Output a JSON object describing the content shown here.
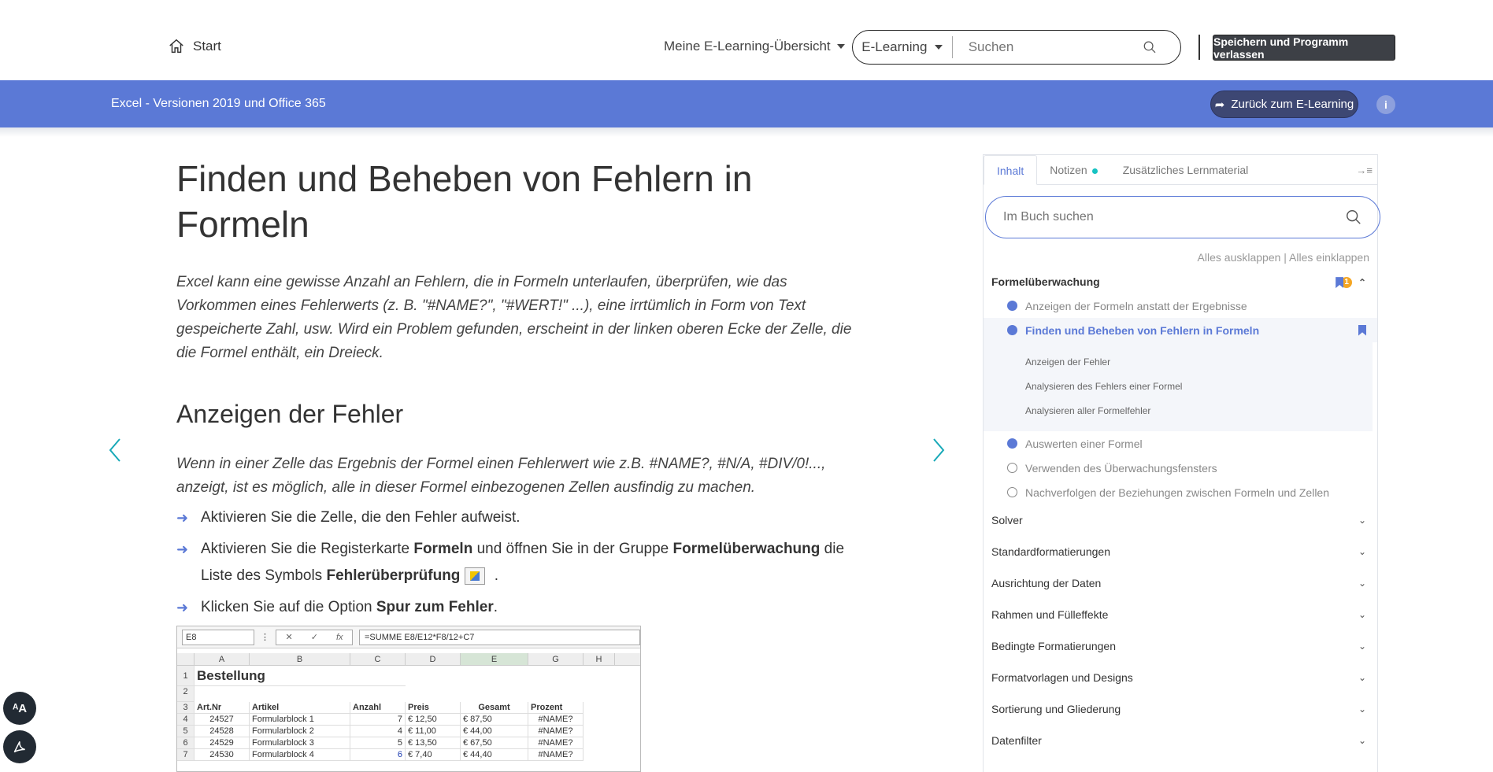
{
  "header": {
    "start": "Start",
    "overview": "Meine E-Learning-Übersicht",
    "search_scope": "E-Learning",
    "search_placeholder": "Suchen",
    "save_exit": "Speichern und Programm verlassen"
  },
  "course_bar": {
    "title": "Excel - Versionen 2019 und Office 365",
    "back": "Zurück zum E-Learning",
    "info": "i"
  },
  "content": {
    "title": "Finden und Beheben von Fehlern in Formeln",
    "intro": "Excel kann eine gewisse Anzahl an Fehlern, die in Formeln unterlaufen, überprüfen, wie das Vorkommen eines Fehlerwerts (z. B. \"#NAME?\", \"#WERT!\" ...), eine irrtümlich in Form von Text gespeicherte Zahl, usw. Wird ein Problem gefunden, erscheint in der linken oberen Ecke der Zelle, die die Formel enthält, ein Dreieck.",
    "section_title": "Anzeigen der Fehler",
    "section_intro": "Wenn in einer Zelle das Ergebnis der Formel einen Fehlerwert wie z.B. #NAME?, #N/A, #DIV/0!..., anzeigt, ist es möglich, alle in dieser Formel einbezogenen Zellen ausfindig zu machen.",
    "step1": "Aktivieren Sie die Zelle, die den Fehler aufweist.",
    "step2_a": "Aktivieren Sie die Registerkarte ",
    "step2_b": "Formeln",
    "step2_c": " und öffnen Sie in der Gruppe ",
    "step2_d": "Formelüberwachung",
    "step2_e": " die Liste des Symbols ",
    "step2_f": "Fehlerüberprüfung",
    "step2_g": " .",
    "step3_a": "Klicken Sie auf die Option ",
    "step3_b": "Spur zum Fehler",
    "step3_c": "."
  },
  "excel": {
    "namebox": "E8",
    "formula": "=SUMME E8/E12*F8/12+C7",
    "columns": [
      "",
      "A",
      "B",
      "C",
      "D",
      "E",
      "G",
      "H"
    ],
    "rows": [
      [
        "1",
        "Bestellung",
        "",
        "",
        "",
        "",
        ""
      ],
      [
        "2",
        "",
        "",
        "",
        "",
        "",
        ""
      ],
      [
        "3",
        "Art.Nr",
        "Artikel",
        "Anzahl",
        "Preis",
        "Gesamt",
        "Prozent"
      ],
      [
        "4",
        "24527",
        "Formularblock 1",
        "7",
        "€     12,50",
        "€        87,50",
        "#NAME?"
      ],
      [
        "5",
        "24528",
        "Formularblock 2",
        "4",
        "€     11,00",
        "€        44,00",
        "#NAME?"
      ],
      [
        "6",
        "24529",
        "Formularblock 3",
        "5",
        "€     13,50",
        "€        67,50",
        "#NAME?"
      ],
      [
        "7",
        "24530",
        "Formularblock 4",
        "6",
        "€       7,40",
        "€        44,40",
        "#NAME?"
      ]
    ]
  },
  "sidebar": {
    "tabs": [
      "Inhalt",
      "Notizen",
      "Zusätzliches Lernmaterial"
    ],
    "search_placeholder": "Im Buch suchen",
    "expand_links": "Alles ausklappen | Alles einklappen",
    "badge_count": "1",
    "current_section": "Formelüberwachung",
    "items": [
      {
        "label": "Anzeigen der Formeln anstatt der Ergebnisse",
        "state": "done"
      },
      {
        "label": "Finden und Beheben von Fehlern in Formeln",
        "state": "current"
      },
      {
        "label": "Auswerten einer Formel",
        "state": "done"
      },
      {
        "label": "Verwenden des Überwachungsfensters",
        "state": "open"
      },
      {
        "label": "Nachverfolgen der Beziehungen zwischen Formeln und Zellen",
        "state": "open"
      }
    ],
    "subitems": [
      "Anzeigen der Fehler",
      "Analysieren des Fehlers einer Formel",
      "Analysieren aller Formelfehler"
    ],
    "sections": [
      "Solver",
      "Standardformatierungen",
      "Ausrichtung der Daten",
      "Rahmen und Fülleffekte",
      "Bedingte Formatierungen",
      "Formatvorlagen und Designs",
      "Sortierung und Gliederung",
      "Datenfilter"
    ]
  },
  "fab": {
    "text_size": "ᴬA"
  },
  "colors": {
    "accent": "#5b79d6",
    "dark_button": "#3d4046",
    "teal": "#16c2c2"
  }
}
